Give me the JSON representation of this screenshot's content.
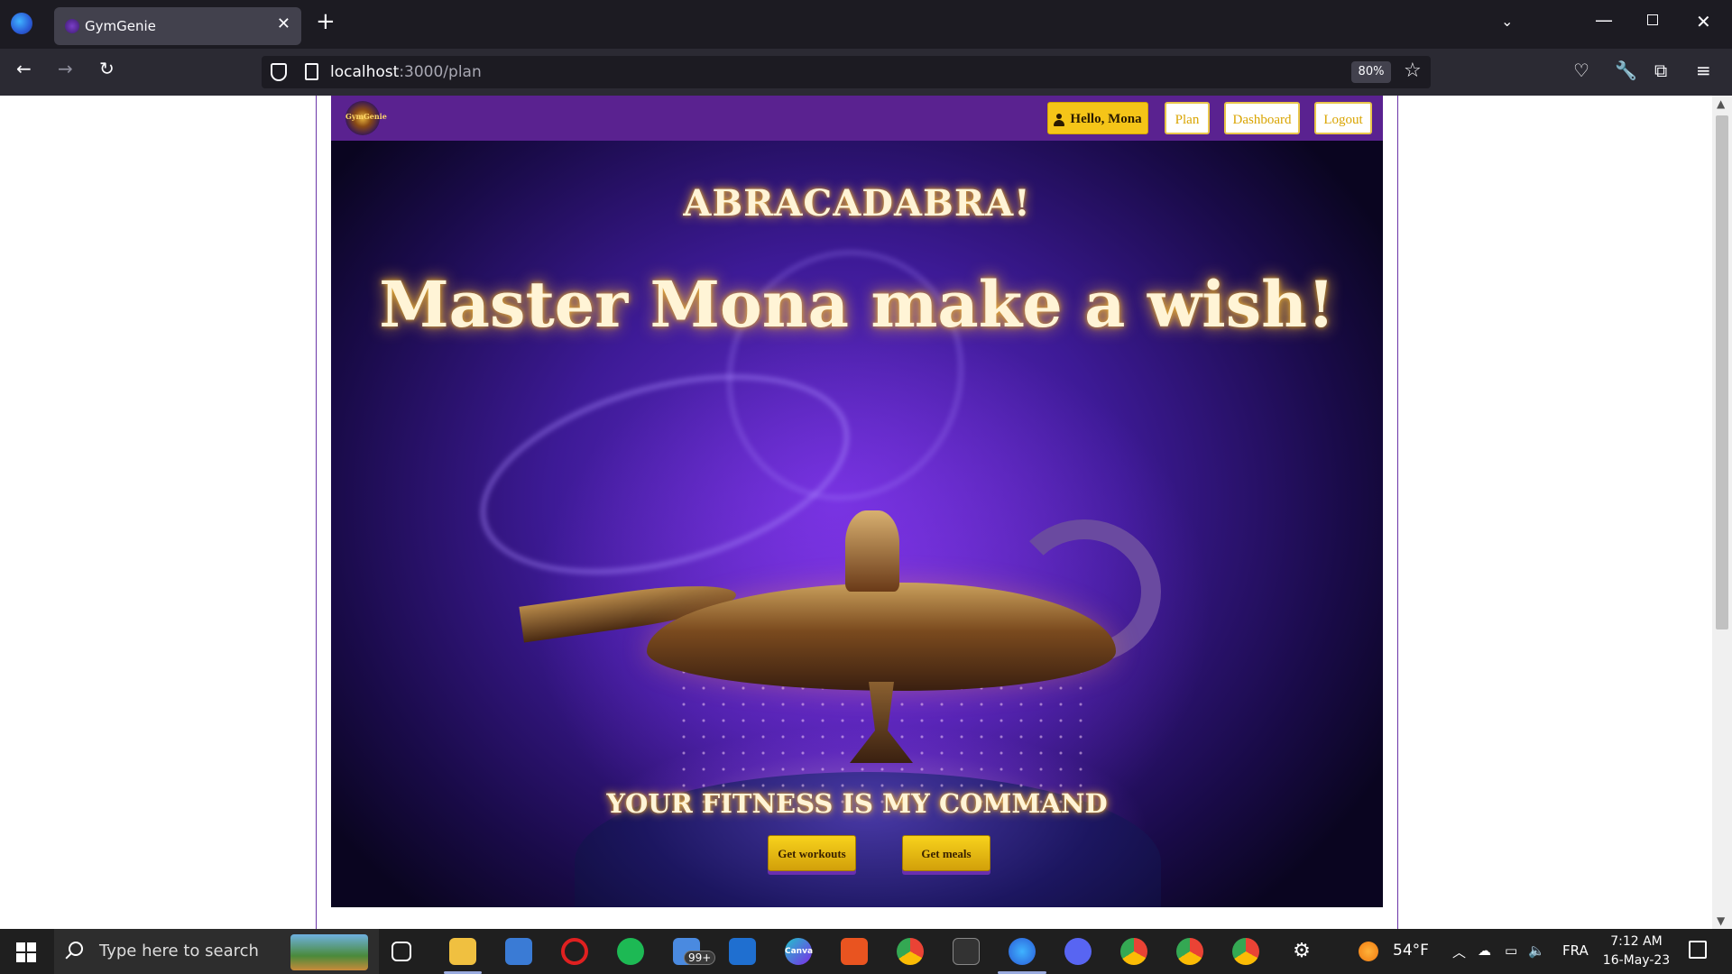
{
  "browser": {
    "tab_title": "GymGenie",
    "tab_close": "✕",
    "new_tab": "+",
    "url_host": "localhost",
    "url_path": ":3000/plan",
    "zoom": "80%",
    "back": "←",
    "forward": "→",
    "reload": "↻",
    "star": "☆",
    "tab_list": "⌄",
    "min": "—",
    "close": "✕"
  },
  "app": {
    "logo_text": "GymGenie",
    "nav": {
      "hello": "Hello, Mona",
      "plan": "Plan",
      "dashboard": "Dashboard",
      "logout": "Logout"
    },
    "hero": {
      "title": "ABRACADABRA!",
      "subtitle": "Master Mona make a wish!",
      "tagline": "YOUR FITNESS IS MY COMMAND",
      "btn_workouts": "Get workouts",
      "btn_meals": "Get meals"
    },
    "colors": {
      "header": "#5a2290",
      "accent": "#f5c518",
      "glow": "#f1b63a"
    }
  },
  "taskbar": {
    "search_placeholder": "Type here to search",
    "mail_badge": "99+",
    "weather": "54°F",
    "language": "FRA",
    "time": "7:12 AM",
    "date": "16-May-23",
    "canva_label": "Canva"
  }
}
